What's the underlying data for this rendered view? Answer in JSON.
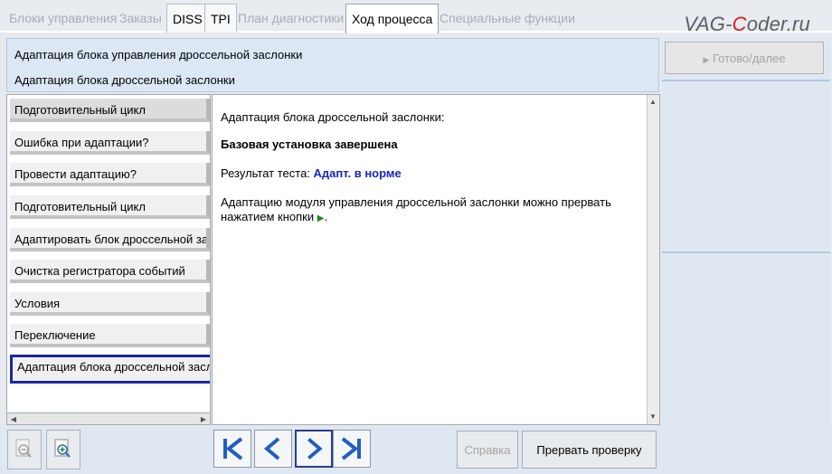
{
  "tabs": [
    {
      "label": "Блоки управления",
      "state": "disabled"
    },
    {
      "label": "Заказы",
      "state": "disabled"
    },
    {
      "label": "DISS",
      "state": "enabled"
    },
    {
      "label": "TPI",
      "state": "enabled"
    },
    {
      "label": "План диагностики",
      "state": "disabled"
    },
    {
      "label": "Ход процесса",
      "state": "active"
    },
    {
      "label": "Специальные функции",
      "state": "disabled"
    }
  ],
  "logo": {
    "part1": "VAG-",
    "part2": "C",
    "part3": "oder.ru"
  },
  "header": {
    "line1": "Адаптация блока управления дроссельной заслонки",
    "line2": "Адаптация блока дроссельной заслонки"
  },
  "right_panel": {
    "ready_button": "Готово/далее",
    "ready_icon": "play-icon"
  },
  "steps": [
    "Подготовительный цикл",
    "Ошибка при адаптации?",
    "Провести адаптацию?",
    "Подготовительный цикл",
    "Адаптировать блок дроссельной заслонки",
    "Очистка регистратора событий",
    "Условия",
    "Переключение",
    "Адаптация блока дроссельной заслонки"
  ],
  "content": {
    "heading": "Адаптация блока дроссельной заслонки:",
    "status": "Базовая установка завершена",
    "result_label": "Результат теста:",
    "result_value": "Адапт. в норме",
    "instruction_line1": "Адаптацию модуля управления дроссельной заслонки можно прервать",
    "instruction_line2": "нажатием кнопки"
  },
  "toolbar": {
    "help_button": "Справка",
    "abort_button": "Прервать проверку"
  },
  "colors": {
    "accent_blue": "#1b25b8",
    "logo_red": "#d41f1f",
    "panel": "#dce7f5"
  }
}
